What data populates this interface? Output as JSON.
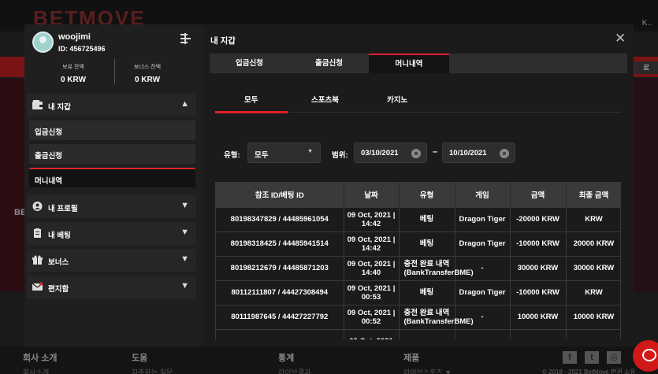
{
  "background": {
    "logo": "BETMOVE",
    "lang": "K..",
    "side_button": "로",
    "banner_text": "BE",
    "footer": [
      {
        "title": "회사 소개",
        "sub": "회사소개"
      },
      {
        "title": "도움",
        "sub": "자주하는 질문"
      },
      {
        "title": "통계",
        "sub": "라이브결과"
      },
      {
        "title": "제품",
        "sub": "라이브스포츠 ▼"
      }
    ],
    "social": [
      "f",
      "t",
      "◎"
    ],
    "copyright": "© 2018 - 2021 BetMove 판권 소유"
  },
  "profile": {
    "username": "woojimi",
    "user_id": "ID: 456725496",
    "balance_label": "보유 잔액",
    "balance_value": "0 KRW",
    "bonus_label": "보너스 잔액",
    "bonus_value": "0 KRW"
  },
  "sidebar": {
    "wallet": "내 지갑",
    "deposit": "입금신청",
    "withdraw": "출금신청",
    "money_history": "머니내역",
    "profile": "내 프로필",
    "bets": "내 베팅",
    "bonus": "보너스",
    "inbox": "편지함"
  },
  "main": {
    "title": "내 지갑",
    "tabs": [
      "입금신청",
      "출금신청",
      "머니내역"
    ],
    "subtabs": [
      "모두",
      "스포츠북",
      "카지노"
    ],
    "filter": {
      "type_label": "유형:",
      "type_value": "모두",
      "range_label": "범위:",
      "date_from": "03/10/2021",
      "date_to": "10/10/2021",
      "dash": "–"
    },
    "table": {
      "headers": [
        "참조 ID/베팅 ID",
        "날짜",
        "유형",
        "게임",
        "금액",
        "최종 금액"
      ],
      "rows": [
        {
          "ref": "80198347829 / 44485961054",
          "date": "09 Oct, 2021 | 14:42",
          "type": "베팅",
          "game": "Dragon Tiger",
          "amount": "-20000 KRW",
          "final": "KRW"
        },
        {
          "ref": "80198318425 / 44485941514",
          "date": "09 Oct, 2021 | 14:42",
          "type": "베팅",
          "game": "Dragon Tiger",
          "amount": "-10000 KRW",
          "final": "20000 KRW"
        },
        {
          "ref": "80198212679 / 44485871203",
          "date": "09 Oct, 2021 | 14:40",
          "type": "충전 완료 내역 (BankTransferBME)",
          "game": "-",
          "amount": "30000 KRW",
          "final": "30000 KRW"
        },
        {
          "ref": "80112111807 / 44427308494",
          "date": "09 Oct, 2021 | 00:53",
          "type": "베팅",
          "game": "Dragon Tiger",
          "amount": "-10000 KRW",
          "final": "KRW"
        },
        {
          "ref": "80111987645 / 44427227792",
          "date": "09 Oct, 2021 | 00:52",
          "type": "충전 완료 내역 (BankTransferBME)",
          "game": "-",
          "amount": "10000 KRW",
          "final": "10000 KRW"
        },
        {
          "ref": "",
          "date": "09 Oct, 2021",
          "type": "",
          "game": "",
          "amount": "",
          "final": ""
        }
      ]
    }
  },
  "colors": {
    "accent": "#e0202a",
    "bg": "#1b1b1b",
    "panel": "#262626"
  }
}
